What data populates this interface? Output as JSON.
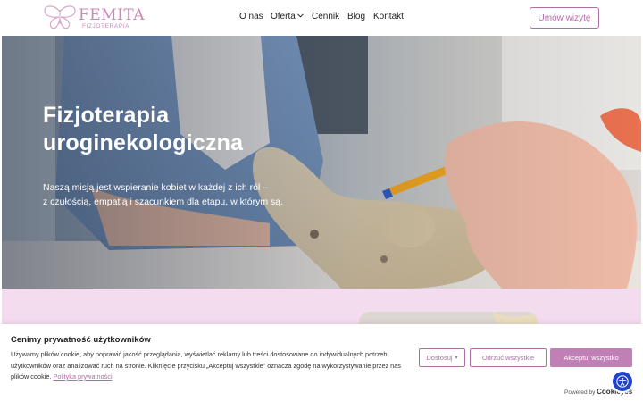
{
  "logo": {
    "name": "FEMITA",
    "subtitle": "FIZJOTERAPIA"
  },
  "nav": {
    "items": [
      {
        "label": "O nas"
      },
      {
        "label": "Oferta",
        "has_dropdown": true
      },
      {
        "label": "Cennik"
      },
      {
        "label": "Blog"
      },
      {
        "label": "Kontakt"
      }
    ],
    "cta_label": "Umów wizytę"
  },
  "hero": {
    "title_line1": "Fizjoterapia",
    "title_line2": "uroginekologiczna",
    "text_line1": "Naszą misją jest wspieranie kobiet w każdej z ich ról –",
    "text_line2": "z czułością, empatią i szacunkiem dla etapu, w którym są."
  },
  "cookie": {
    "title": "Cenimy prywatność użytkowników",
    "text": "Używamy plików cookie, aby poprawić jakość przeglądania, wyświetlać reklamy lub treści dostosowane do indywidualnych potrzeb użytkowników oraz analizować ruch na stronie. Kliknięcie przycisku „Akceptuj wszystkie\" oznacza zgodę na wykorzystywanie przez nas plików cookie.",
    "link_label": "Polityka prywatności",
    "customize_label": "Dostosuj",
    "reject_label": "Odrzuć wszystkie",
    "accept_label": "Akceptuj wszystko",
    "powered_prefix": "Powered by",
    "powered_brand": "Cookieyes"
  },
  "colors": {
    "brand": "#b06fa4",
    "accent_button": "#c07fb5",
    "pink_band": "#f4dcef",
    "accessibility_button": "#1f43c9"
  },
  "icons": {
    "logo": "butterfly-logo-icon",
    "dropdown": "chevron-down-icon",
    "accessibility": "accessibility-icon"
  }
}
